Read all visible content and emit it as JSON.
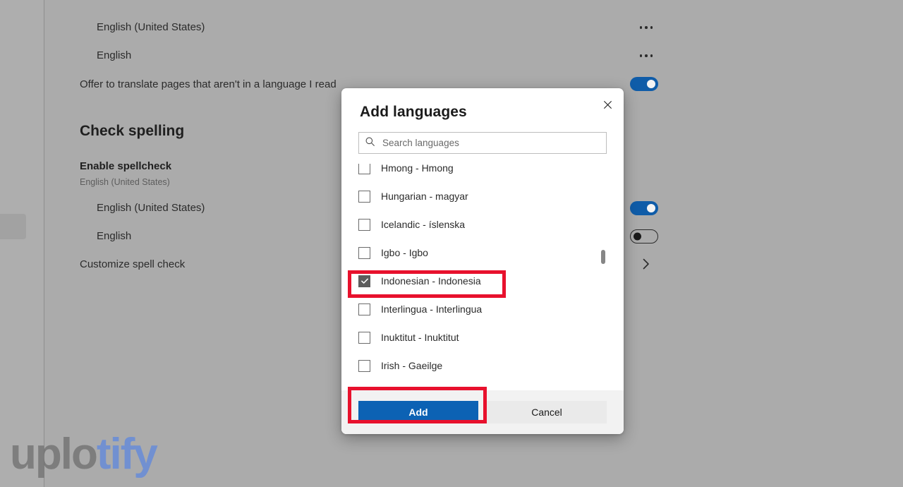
{
  "background_page": {
    "language_entries": [
      {
        "label": "English (United States)",
        "menu_icon": "more-horizontal-icon"
      },
      {
        "label": "English",
        "menu_icon": "more-horizontal-icon"
      }
    ],
    "translate_setting": {
      "label": "Offer to translate pages that aren't in a language I read",
      "toggle_state": "on"
    },
    "spelling_section": {
      "heading": "Check spelling",
      "enable_spellcheck_label": "Enable spellcheck",
      "enable_spellcheck_sub": "English (United States)",
      "enable_spellcheck_toggle_state": "on",
      "dictionary_entries": [
        {
          "label": "English (United States)",
          "toggle_state": "on"
        },
        {
          "label": "English",
          "toggle_state": "off"
        }
      ],
      "customize_label": "Customize spell check",
      "customize_icon": "chevron-right-icon"
    }
  },
  "dialog": {
    "title": "Add languages",
    "close_icon": "close-icon",
    "search": {
      "icon": "search-icon",
      "placeholder": "Search languages",
      "value": ""
    },
    "languages": [
      {
        "label": "Hmong - Hmong",
        "checked": false,
        "clipped": true
      },
      {
        "label": "Hungarian - magyar",
        "checked": false,
        "clipped": false
      },
      {
        "label": "Icelandic - íslenska",
        "checked": false,
        "clipped": false
      },
      {
        "label": "Igbo - Igbo",
        "checked": false,
        "clipped": false
      },
      {
        "label": "Indonesian - Indonesia",
        "checked": true,
        "clipped": false
      },
      {
        "label": "Interlingua - Interlingua",
        "checked": false,
        "clipped": false
      },
      {
        "label": "Inuktitut - Inuktitut",
        "checked": false,
        "clipped": false
      },
      {
        "label": "Irish - Gaeilge",
        "checked": false,
        "clipped": false
      }
    ],
    "buttons": {
      "add_label": "Add",
      "cancel_label": "Cancel"
    }
  },
  "watermark": {
    "part_a": "uplo",
    "part_b": "tify"
  },
  "colors": {
    "accent_blue": "#0c62b4",
    "toggle_on": "#0f5ca8",
    "annotation_red": "#e8112d",
    "scrim": "#ababab",
    "footer_bg": "#f2f2f2"
  }
}
